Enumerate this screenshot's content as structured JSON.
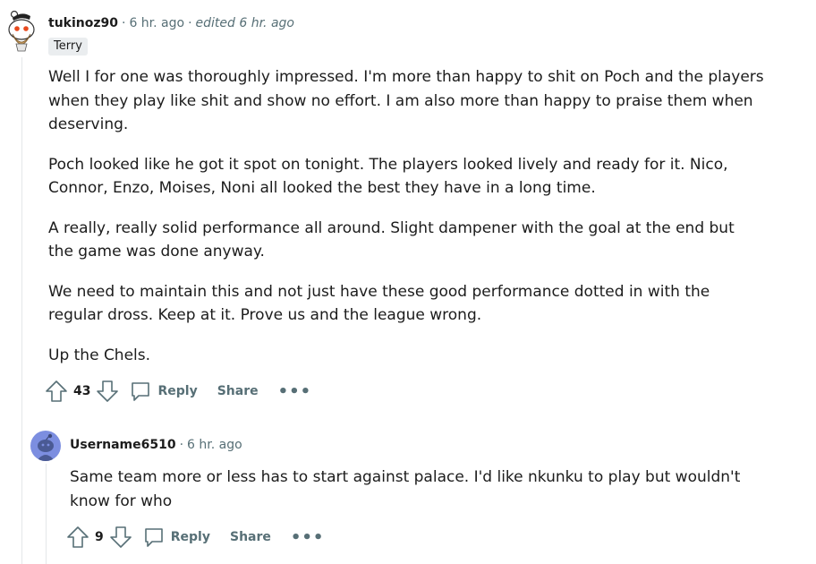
{
  "comment1": {
    "username": "tukinoz90",
    "time": "6 hr. ago",
    "edited": "edited 6 hr. ago",
    "flair": "Terry",
    "paragraphs": [
      "Well I for one was thoroughly impressed. I'm more than happy to shit on Poch and the players when they play like shit and show no effort. I am also more than happy to praise them when deserving.",
      "Poch looked like he got it spot on tonight. The players looked lively and ready for it. Nico, Connor, Enzo, Moises, Noni all looked the best they have in a long time.",
      "A really, really solid performance all around. Slight dampener with the goal at the end but the game was done anyway.",
      "We need to maintain this and not just have these good performance dotted in with the regular dross. Keep at it. Prove us and the league wrong.",
      "Up the Chels."
    ],
    "votes": "43",
    "reply_label": "Reply",
    "share_label": "Share",
    "more_label": "•••"
  },
  "comment2": {
    "username": "Username6510",
    "time": "6 hr. ago",
    "paragraphs": [
      "Same team more or less has to start against palace. I'd like nkunku to play but wouldn't know for who"
    ],
    "votes": "9",
    "reply_label": "Reply",
    "share_label": "Share",
    "more_label": "•••"
  },
  "icons": {
    "upvote": "upvote-arrow-icon",
    "downvote": "downvote-arrow-icon",
    "reply": "speech-bubble-icon",
    "avatar1": "snoo-avatar-icon",
    "avatar2": "snoo-avatar-icon"
  },
  "colors": {
    "meta": "#576f76",
    "text": "#1c1c1c",
    "flair_bg": "#eaedef",
    "thread_line": "#e5e7e9",
    "avatar2_bg": "#7c8ee0"
  }
}
